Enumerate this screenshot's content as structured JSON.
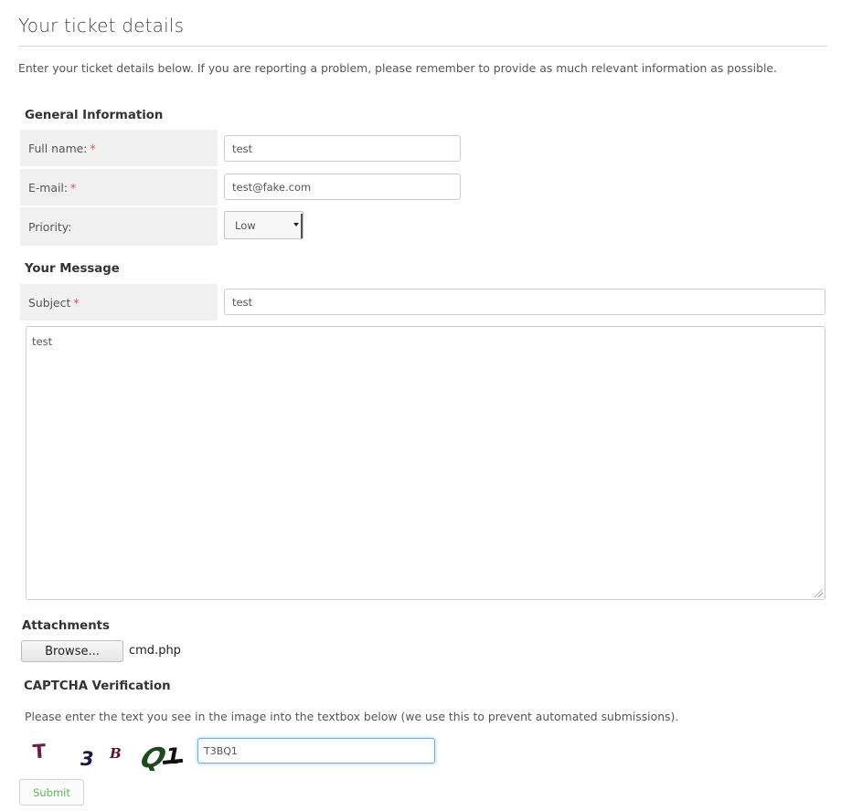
{
  "header": {
    "title": "Your ticket details",
    "intro": "Enter your ticket details below. If you are reporting a problem, please remember to provide as much relevant information as possible."
  },
  "general": {
    "heading": "General Information",
    "full_name": {
      "label": "Full name:",
      "required_mark": "*",
      "value": "test"
    },
    "email": {
      "label": "E-mail:",
      "required_mark": "*",
      "value": "test@fake.com"
    },
    "priority": {
      "label": "Priority:",
      "selected": "Low"
    }
  },
  "message": {
    "heading": "Your Message",
    "subject": {
      "label": "Subject",
      "required_mark": "*",
      "value": "test"
    },
    "body": "test"
  },
  "attachments": {
    "heading": "Attachments",
    "browse_label": "Browse...",
    "file_name": "cmd.php"
  },
  "captcha": {
    "heading": "CAPTCHA Verification",
    "instructions": "Please enter the text you see in the image into the textbox below (we use this to prevent automated submissions).",
    "image_text": "T3BQ1",
    "input_value": "T3BQ1"
  },
  "form": {
    "submit_label": "Submit"
  },
  "colors": {
    "required": "#d9534f",
    "label_bg": "#f0f0f0",
    "submit_text": "#5cb85c",
    "focus_border": "#66afe9"
  }
}
